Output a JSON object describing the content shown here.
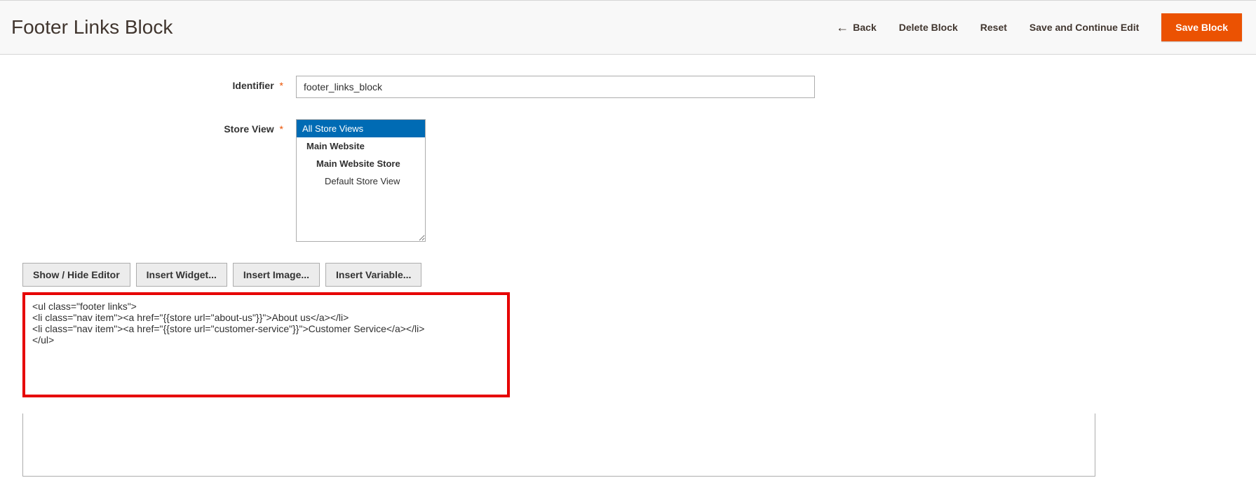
{
  "header": {
    "title": "Footer Links Block",
    "back": "Back",
    "delete": "Delete Block",
    "reset": "Reset",
    "save_continue": "Save and Continue Edit",
    "save": "Save Block"
  },
  "fields": {
    "identifier_label": "Identifier",
    "identifier_value": "footer_links_block",
    "store_view_label": "Store View",
    "store_view_options": {
      "all": "All Store Views",
      "main_website": "Main Website",
      "main_website_store": "Main Website Store",
      "default_store_view": "Default Store View"
    }
  },
  "toolbar": {
    "toggle_editor": "Show / Hide Editor",
    "insert_widget": "Insert Widget...",
    "insert_image": "Insert Image...",
    "insert_variable": "Insert Variable..."
  },
  "editor": {
    "content": "<ul class=\"footer links\">\n<li class=\"nav item\"><a href=\"{{store url=\"about-us\"}}\">About us</a></li>\n<li class=\"nav item\"><a href=\"{{store url=\"customer-service\"}}\">Customer Service</a></li>\n</ul>"
  }
}
